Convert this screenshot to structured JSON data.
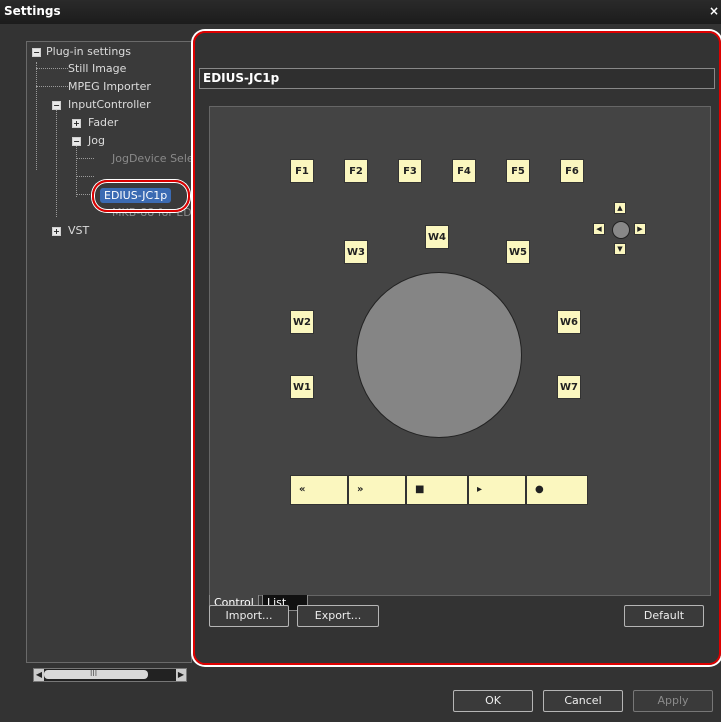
{
  "window": {
    "title": "Settings",
    "close_glyph": "×"
  },
  "tree": {
    "items": [
      {
        "label": "Plug-in settings"
      },
      {
        "label": "Still Image"
      },
      {
        "label": "MPEG Importer"
      },
      {
        "label": "InputController"
      },
      {
        "label": "Fader"
      },
      {
        "label": "Jog"
      },
      {
        "label": "JogDevice Sele"
      },
      {
        "label": "EDIUS-JC1p"
      },
      {
        "label": "MKB-88 for ED"
      },
      {
        "label": "VST"
      }
    ],
    "selected": "EDIUS-JC1p",
    "scrollbar_glyph": "III"
  },
  "panel": {
    "title": "EDIUS-JC1p"
  },
  "function_keys": [
    "F1",
    "F2",
    "F3",
    "F4",
    "F5",
    "F6"
  ],
  "wheel_keys": [
    "W1",
    "W2",
    "W3",
    "W4",
    "W5",
    "W6",
    "W7"
  ],
  "dpad": {
    "up": "▲",
    "down": "▼",
    "left": "◀",
    "right": "▶"
  },
  "transport": [
    "«",
    "»",
    "■",
    "▸",
    "●"
  ],
  "tabs": [
    {
      "label": "Control",
      "active": true
    },
    {
      "label": "List",
      "active": false
    }
  ],
  "buttons": {
    "import": "Import...",
    "export": "Export...",
    "default": "Default",
    "ok": "OK",
    "cancel": "Cancel",
    "apply": "Apply"
  },
  "colors": {
    "key_fill": "#fbf7bf",
    "highlight_ring": "#dd0000",
    "selection": "#3b6bb3"
  }
}
